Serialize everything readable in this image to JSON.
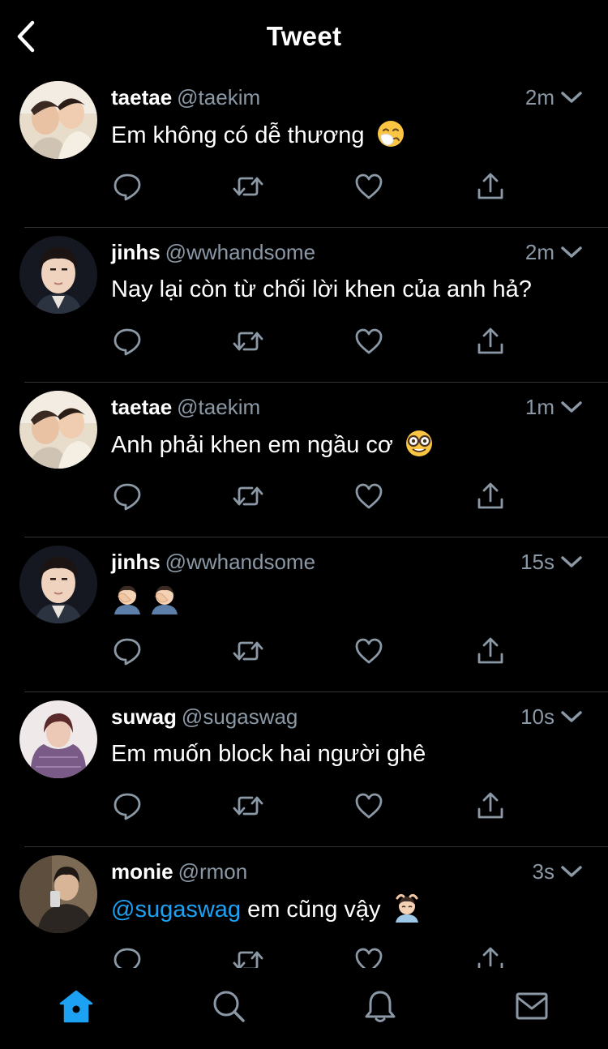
{
  "header": {
    "title": "Tweet",
    "back_icon": "chevron-left-icon"
  },
  "colors": {
    "background": "#000000",
    "accent": "#1da1f2",
    "secondary_text": "#8b98a5",
    "icon": "#8b98a5",
    "separator": "#2f3336"
  },
  "tweets": [
    {
      "name": "taetae",
      "handle": "@taekim",
      "time": "2m",
      "text": "Em không có dễ thương",
      "mention": "",
      "emoji": "sneezing-face"
    },
    {
      "name": "jinhs",
      "handle": "@wwhandsome",
      "time": "2m",
      "text": "Nay lại còn từ chối lời khen của anh hả?",
      "mention": "",
      "emoji": ""
    },
    {
      "name": "taetae",
      "handle": "@taekim",
      "time": "1m",
      "text": "Anh phải khen em ngầu cơ",
      "mention": "",
      "emoji": "nerd-face"
    },
    {
      "name": "jinhs",
      "handle": "@wwhandsome",
      "time": "15s",
      "text": "",
      "mention": "",
      "emoji": "facepalm-x2"
    },
    {
      "name": "suwag",
      "handle": "@sugaswag",
      "time": "10s",
      "text": "Em muốn block hai người ghê",
      "mention": "",
      "emoji": ""
    },
    {
      "name": "monie",
      "handle": "@rmon",
      "time": "3s",
      "text": "em cũng vậy",
      "mention": "@sugaswag",
      "emoji": "man-getting-face-massage"
    }
  ],
  "tweet_actions": [
    "reply-icon",
    "retweet-icon",
    "like-icon",
    "share-icon"
  ],
  "tabbar": {
    "items": [
      "home-icon",
      "search-icon",
      "notifications-icon",
      "messages-icon"
    ],
    "active": "home-icon"
  }
}
